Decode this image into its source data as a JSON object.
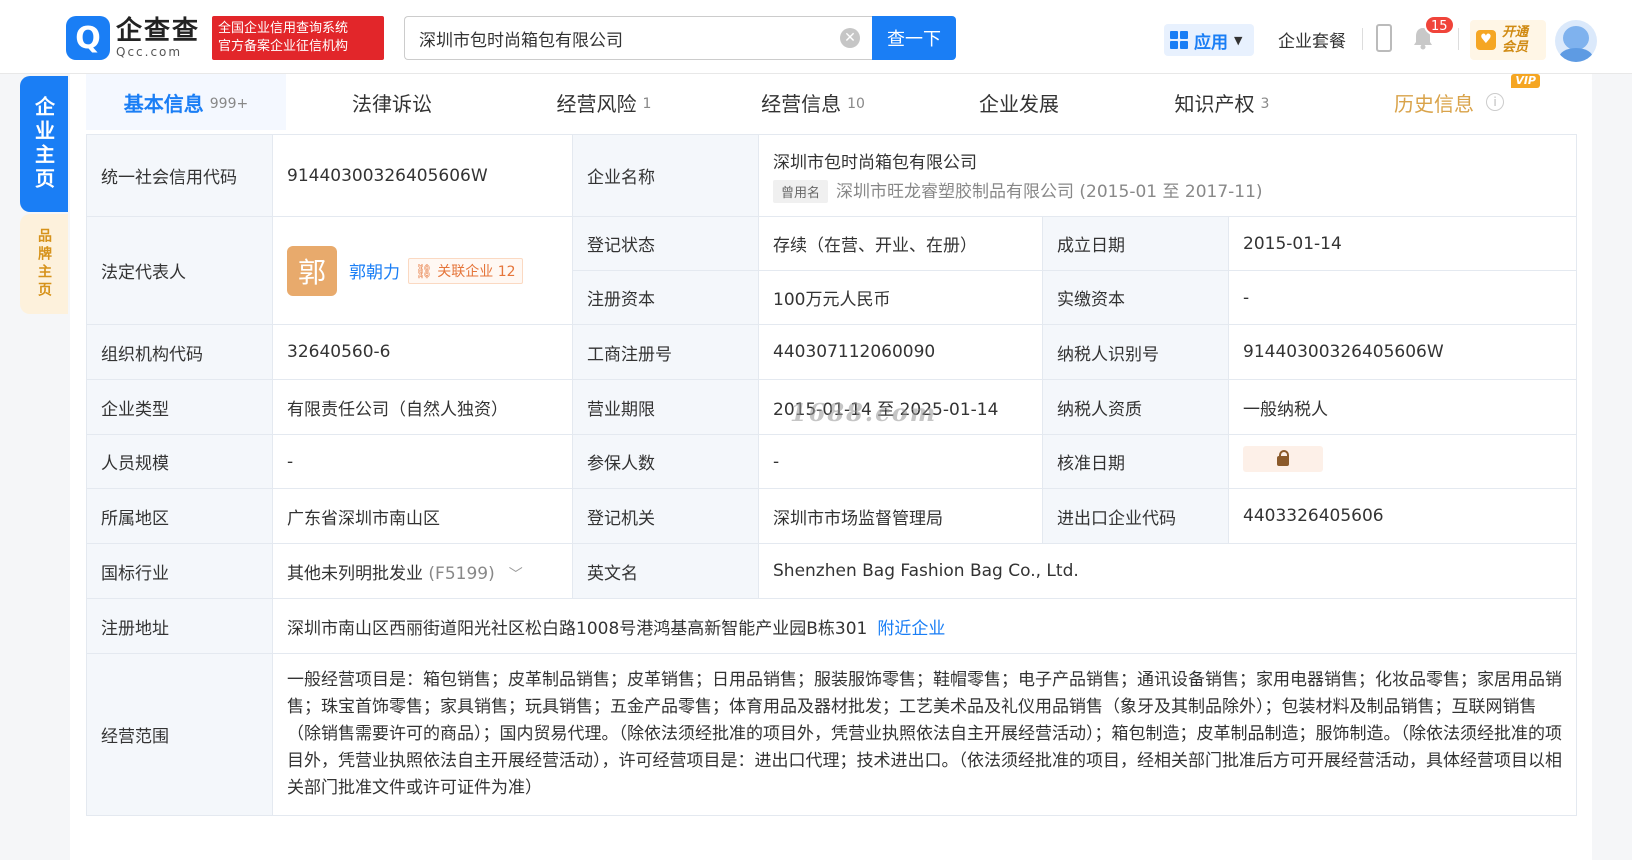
{
  "header": {
    "logo_mark": "Q",
    "logo_cn": "企查查",
    "logo_en": "Qcc.com",
    "logo_tag_line1": "全国企业信用查询系统",
    "logo_tag_line2": "官方备案企业征信机构",
    "search_value": "深圳市包时尚箱包有限公司",
    "search_button": "查一下",
    "app_label": "应用",
    "package_label": "企业套餐",
    "notification_count": "15",
    "vip_line1": "开通",
    "vip_line2": "会员"
  },
  "side_tabs": {
    "main": "企业主页",
    "brand": "品牌主页"
  },
  "tabs": [
    {
      "label": "基本信息",
      "count": "999+"
    },
    {
      "label": "法律诉讼",
      "count": ""
    },
    {
      "label": "经营风险",
      "count": "1"
    },
    {
      "label": "经营信息",
      "count": "10"
    },
    {
      "label": "企业发展",
      "count": ""
    },
    {
      "label": "知识产权",
      "count": "3"
    },
    {
      "label": "历史信息",
      "count": "",
      "badge": "VIP"
    }
  ],
  "info": {
    "credit_code_label": "统一社会信用代码",
    "credit_code": "91440300326405606W",
    "company_name_label": "企业名称",
    "company_name": "深圳市包时尚箱包有限公司",
    "former_tag": "曾用名",
    "former_name": "深圳市旺龙睿塑胶制品有限公司 (2015-01 至 2017-11)",
    "legal_rep_label": "法定代表人",
    "legal_rep_avatar": "郭",
    "legal_rep_name": "郭朝力",
    "related_label": "关联企业",
    "related_count": "12",
    "status_label": "登记状态",
    "status": "存续（在营、开业、在册）",
    "founded_label": "成立日期",
    "founded": "2015-01-14",
    "reg_capital_label": "注册资本",
    "reg_capital": "100万元人民币",
    "paid_capital_label": "实缴资本",
    "paid_capital": "-",
    "org_code_label": "组织机构代码",
    "org_code": "32640560-6",
    "biz_reg_no_label": "工商注册号",
    "biz_reg_no": "440307112060090",
    "taxpayer_id_label": "纳税人识别号",
    "taxpayer_id": "91440300326405606W",
    "company_type_label": "企业类型",
    "company_type": "有限责任公司（自然人独资）",
    "biz_term_label": "营业期限",
    "biz_term": "2015-01-14 至 2025-01-14",
    "taxpayer_qual_label": "纳税人资质",
    "taxpayer_qual": "一般纳税人",
    "staff_size_label": "人员规模",
    "staff_size": "-",
    "insured_label": "参保人数",
    "insured": "-",
    "approval_date_label": "核准日期",
    "region_label": "所属地区",
    "region": "广东省深圳市南山区",
    "reg_authority_label": "登记机关",
    "reg_authority": "深圳市市场监督管理局",
    "import_export_label": "进出口企业代码",
    "import_export": "4403326405606",
    "industry_label": "国标行业",
    "industry": "其他未列明批发业",
    "industry_code": "(F5199)",
    "english_name_label": "英文名",
    "english_name": "Shenzhen Bag Fashion Bag Co., Ltd.",
    "address_label": "注册地址",
    "address": "深圳市南山区西丽街道阳光社区松白路1008号港鸿基高新智能产业园B栋301",
    "nearby_link": "附近企业",
    "scope_label": "经营范围",
    "scope": "一般经营项目是：箱包销售；皮革制品销售；皮革销售；日用品销售；服装服饰零售；鞋帽零售；电子产品销售；通讯设备销售；家用电器销售；化妆品零售；家居用品销售；珠宝首饰零售；家具销售；玩具销售；五金产品零售；体育用品及器材批发；工艺美术品及礼仪用品销售（象牙及其制品除外）；包装材料及制品销售；互联网销售（除销售需要许可的商品）；国内贸易代理。（除依法须经批准的项目外，凭营业执照依法自主开展经营活动）；箱包制造；皮革制品制造；服饰制造。（除依法须经批准的项目外，凭营业执照依法自主开展经营活动），许可经营项目是：进出口代理；技术进出口。（依法须经批准的项目，经相关部门批准后方可开展经营活动，具体经营项目以相关部门批准文件或许可证件为准）"
  },
  "watermark": "1688.com"
}
